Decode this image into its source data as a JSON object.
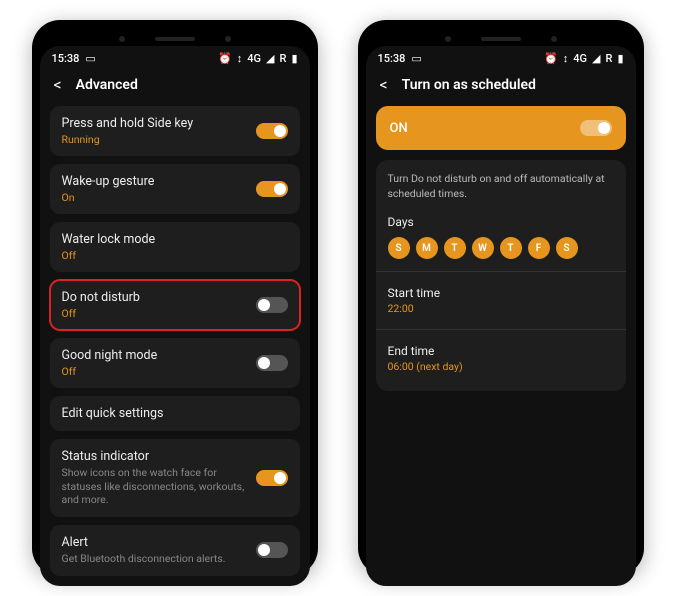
{
  "status": {
    "time": "15:38",
    "icons": {
      "alarm": "⏰",
      "data": "↕",
      "net": "4G",
      "signal": "◢",
      "roam": "R",
      "batt": "▮"
    }
  },
  "left": {
    "title": "Advanced",
    "rows": [
      {
        "label": "Press and hold Side key",
        "sub": "Running",
        "subClass": "orange",
        "toggle": "on"
      },
      {
        "label": "Wake-up gesture",
        "sub": "On",
        "subClass": "orange",
        "toggle": "on"
      },
      {
        "label": "Water lock mode",
        "sub": "Off",
        "subClass": "orange",
        "toggle": null
      },
      {
        "label": "Do not disturb",
        "sub": "Off",
        "subClass": "orange",
        "toggle": "off",
        "highlight": true
      },
      {
        "label": "Good night mode",
        "sub": "Off",
        "subClass": "orange",
        "toggle": "off"
      },
      {
        "label": "Edit quick settings",
        "sub": "",
        "subClass": "",
        "toggle": null
      },
      {
        "label": "Status indicator",
        "sub": "Show icons on the watch face for statuses like disconnections, workouts, and more.",
        "subClass": "muted",
        "toggle": "on"
      },
      {
        "label": "Alert",
        "sub": "Get Bluetooth disconnection alerts.",
        "subClass": "muted",
        "toggle": "off"
      }
    ]
  },
  "right": {
    "title": "Turn on as scheduled",
    "onLabel": "ON",
    "desc": "Turn Do not disturb on and off automatically at scheduled times.",
    "daysLabel": "Days",
    "days": [
      "S",
      "M",
      "T",
      "W",
      "T",
      "F",
      "S"
    ],
    "start": {
      "label": "Start time",
      "val": "22:00"
    },
    "end": {
      "label": "End time",
      "val": "06:00 (next day)"
    }
  }
}
